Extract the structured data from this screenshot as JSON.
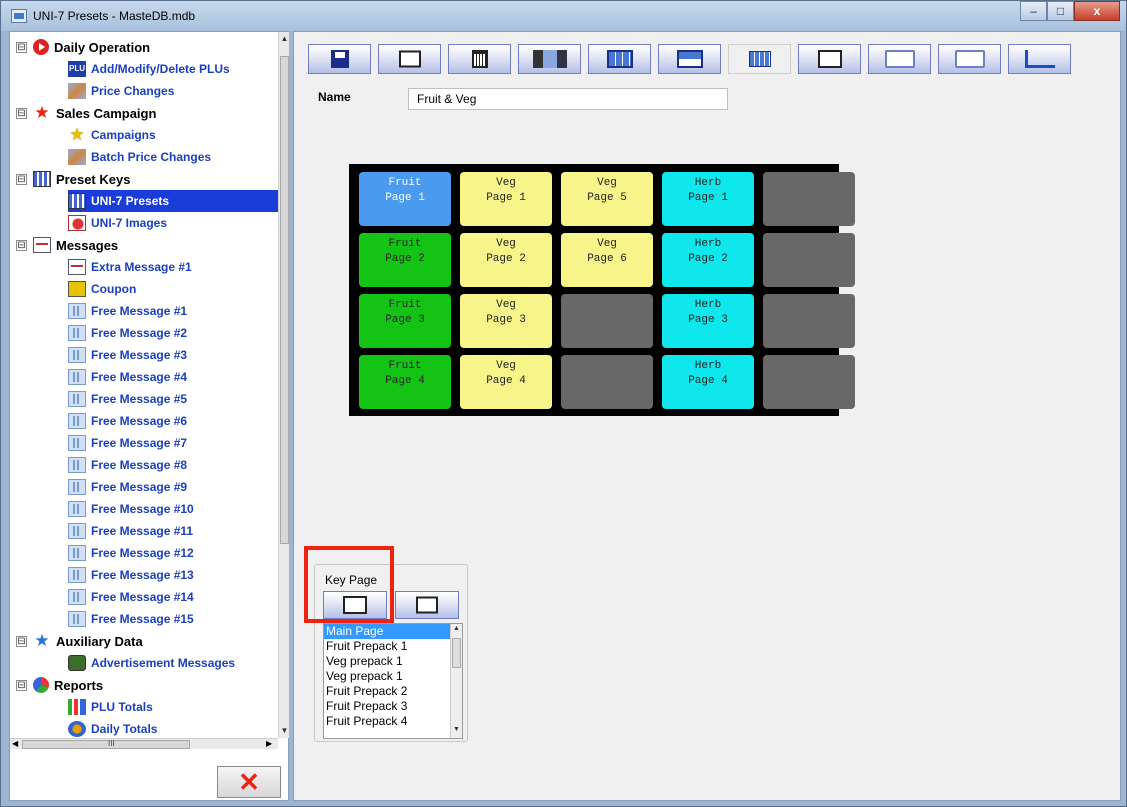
{
  "window": {
    "title": "UNI-7 Presets - MasteDB.mdb",
    "minimize": "–",
    "maximize": "□",
    "close": "x"
  },
  "tree": [
    {
      "label": "Daily Operation",
      "level": 0,
      "category": true,
      "expand": "⊟",
      "icon": "play-icon"
    },
    {
      "label": "Add/Modify/Delete PLUs",
      "level": 1,
      "icon": "plu-icon"
    },
    {
      "label": "Price Changes",
      "level": 1,
      "icon": "price-tag-icon"
    },
    {
      "label": "Sales Campaign",
      "level": 0,
      "category": true,
      "expand": "⊟",
      "icon": "star-icon"
    },
    {
      "label": "Campaigns",
      "level": 1,
      "icon": "yellow-star-icon"
    },
    {
      "label": "Batch Price Changes",
      "level": 1,
      "icon": "price-tag-icon"
    },
    {
      "label": "Preset Keys",
      "level": 0,
      "category": true,
      "expand": "⊟",
      "icon": "keypad-icon"
    },
    {
      "label": "UNI-7 Presets",
      "level": 1,
      "icon": "keypad-icon",
      "selected": true
    },
    {
      "label": "UNI-7 Images",
      "level": 1,
      "icon": "image-icon"
    },
    {
      "label": "Messages",
      "level": 0,
      "category": true,
      "expand": "⊟",
      "icon": "message-icon"
    },
    {
      "label": "Extra Message #1",
      "level": 1,
      "icon": "message-icon"
    },
    {
      "label": "Coupon",
      "level": 1,
      "icon": "coupon-icon"
    },
    {
      "label": "Free Message #1",
      "level": 1,
      "icon": "free-message-icon"
    },
    {
      "label": "Free Message #2",
      "level": 1,
      "icon": "free-message-icon"
    },
    {
      "label": "Free Message #3",
      "level": 1,
      "icon": "free-message-icon"
    },
    {
      "label": "Free Message #4",
      "level": 1,
      "icon": "free-message-icon"
    },
    {
      "label": "Free Message #5",
      "level": 1,
      "icon": "free-message-icon"
    },
    {
      "label": "Free Message #6",
      "level": 1,
      "icon": "free-message-icon"
    },
    {
      "label": "Free Message #7",
      "level": 1,
      "icon": "free-message-icon"
    },
    {
      "label": "Free Message #8",
      "level": 1,
      "icon": "free-message-icon"
    },
    {
      "label": "Free Message #9",
      "level": 1,
      "icon": "free-message-icon"
    },
    {
      "label": "Free Message #10",
      "level": 1,
      "icon": "free-message-icon"
    },
    {
      "label": "Free Message #11",
      "level": 1,
      "icon": "free-message-icon"
    },
    {
      "label": "Free Message #12",
      "level": 1,
      "icon": "free-message-icon"
    },
    {
      "label": "Free Message #13",
      "level": 1,
      "icon": "free-message-icon"
    },
    {
      "label": "Free Message #14",
      "level": 1,
      "icon": "free-message-icon"
    },
    {
      "label": "Free Message #15",
      "level": 1,
      "icon": "free-message-icon"
    },
    {
      "label": "Auxiliary Data",
      "level": 0,
      "category": true,
      "expand": "⊟",
      "icon": "blue-star-icon"
    },
    {
      "label": "Advertisement Messages",
      "level": 1,
      "icon": "advertisement-icon"
    },
    {
      "label": "Reports",
      "level": 0,
      "category": true,
      "expand": "⊟",
      "icon": "pie-chart-icon"
    },
    {
      "label": "PLU Totals",
      "level": 1,
      "icon": "bar-chart-icon"
    },
    {
      "label": "Daily Totals",
      "level": 1,
      "icon": "daily-totals-icon"
    }
  ],
  "hscroll_grip": "III",
  "delete_button": "✕",
  "toolbar": [
    {
      "name": "save-button",
      "icon": "save-icon"
    },
    {
      "name": "new-button",
      "icon": "new-page-icon"
    },
    {
      "name": "delete-button",
      "icon": "trash-icon"
    },
    {
      "name": "image-button",
      "icon": "picture-icon"
    },
    {
      "name": "layout-button",
      "icon": "window-icon"
    },
    {
      "name": "layout2-button",
      "icon": "window-header-icon"
    },
    {
      "name": "grid-button",
      "icon": "grid-icon",
      "flat": true
    },
    {
      "name": "edit-page-button",
      "icon": "edit-page-icon"
    },
    {
      "name": "export-button",
      "icon": "folder-export-icon"
    },
    {
      "name": "import-button",
      "icon": "folder-import-icon"
    },
    {
      "name": "back-button",
      "icon": "return-arrow-icon"
    }
  ],
  "form": {
    "name_label": "Name",
    "name_value": "Fruit & Veg"
  },
  "keys": [
    [
      {
        "line1": "Fruit",
        "line2": "Page 1",
        "color": "blue"
      },
      {
        "line1": "Veg",
        "line2": "Page 1",
        "color": "yellow"
      },
      {
        "line1": "Veg",
        "line2": "Page 5",
        "color": "yellow"
      },
      {
        "line1": "Herb",
        "line2": "Page 1",
        "color": "cyan"
      },
      {
        "line1": "",
        "line2": "",
        "color": "empty"
      }
    ],
    [
      {
        "line1": "Fruit",
        "line2": "Page 2",
        "color": "green"
      },
      {
        "line1": "Veg",
        "line2": "Page 2",
        "color": "yellow"
      },
      {
        "line1": "Veg",
        "line2": "Page 6",
        "color": "yellow"
      },
      {
        "line1": "Herb",
        "line2": "Page 2",
        "color": "cyan"
      },
      {
        "line1": "",
        "line2": "",
        "color": "empty"
      }
    ],
    [
      {
        "line1": "Fruit",
        "line2": "Page 3",
        "color": "green"
      },
      {
        "line1": "Veg",
        "line2": "Page 3",
        "color": "yellow"
      },
      {
        "line1": "",
        "line2": "",
        "color": "empty"
      },
      {
        "line1": "Herb",
        "line2": "Page 3",
        "color": "cyan"
      },
      {
        "line1": "",
        "line2": "",
        "color": "empty"
      }
    ],
    [
      {
        "line1": "Fruit",
        "line2": "Page 4",
        "color": "green"
      },
      {
        "line1": "Veg",
        "line2": "Page 4",
        "color": "yellow"
      },
      {
        "line1": "",
        "line2": "",
        "color": "empty"
      },
      {
        "line1": "Herb",
        "line2": "Page 4",
        "color": "cyan"
      },
      {
        "line1": "",
        "line2": "",
        "color": "empty"
      }
    ]
  ],
  "key_page": {
    "title": "Key Page",
    "pages": [
      "Main Page",
      "Fruit Prepack 1",
      "Veg prepack 1",
      "Veg prepack 1",
      "Fruit Prepack 2",
      "Fruit Prepack 3",
      "Fruit Prepack 4"
    ],
    "selected_index": 0
  },
  "colors": {
    "selection": "#1a3cd9",
    "highlight_box": "#e21111",
    "key_blue": "#4a9bf0",
    "key_green": "#14c414",
    "key_yellow": "#f7f58a",
    "key_cyan": "#0ee8ec",
    "key_empty": "#686868"
  }
}
